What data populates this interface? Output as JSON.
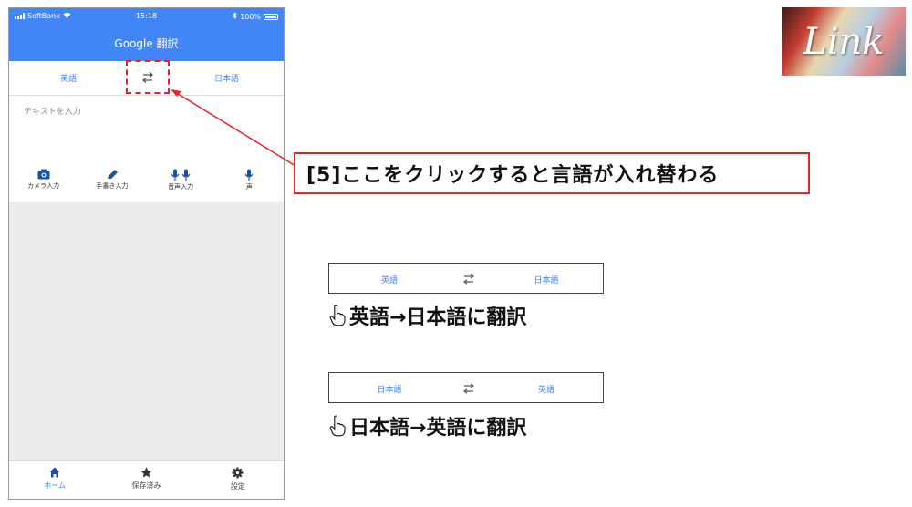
{
  "status_bar": {
    "carrier": "SoftBank",
    "time": "15:18",
    "battery": "100%"
  },
  "app_title": "Google 翻訳",
  "language_bar": {
    "source": "英語",
    "target": "日本語",
    "swap_icon": "swap-arrows-icon"
  },
  "input": {
    "placeholder": "テキストを入力"
  },
  "input_tools": [
    {
      "label": "カメラ入力",
      "icon": "camera-icon"
    },
    {
      "label": "手書き入力",
      "icon": "pen-icon"
    },
    {
      "label": "音声入力",
      "icon": "dual-mic-icon"
    },
    {
      "label": "声",
      "icon": "mic-icon"
    }
  ],
  "bottom_nav": [
    {
      "label": "ホーム",
      "icon": "home-icon",
      "active": true
    },
    {
      "label": "保存済み",
      "icon": "star-icon",
      "active": false
    },
    {
      "label": "設定",
      "icon": "gear-icon",
      "active": false
    }
  ],
  "callout_text": "[5]ここをクリックすると言語が入れ替わる",
  "logo_text": "Link",
  "examples": [
    {
      "source": "英語",
      "target": "日本語",
      "caption": "英語→日本語に翻訳"
    },
    {
      "source": "日本語",
      "target": "英語",
      "caption": "日本語→英語に翻訳"
    }
  ],
  "colors": {
    "accent": "#4285f4",
    "highlight": "#e0242a"
  }
}
